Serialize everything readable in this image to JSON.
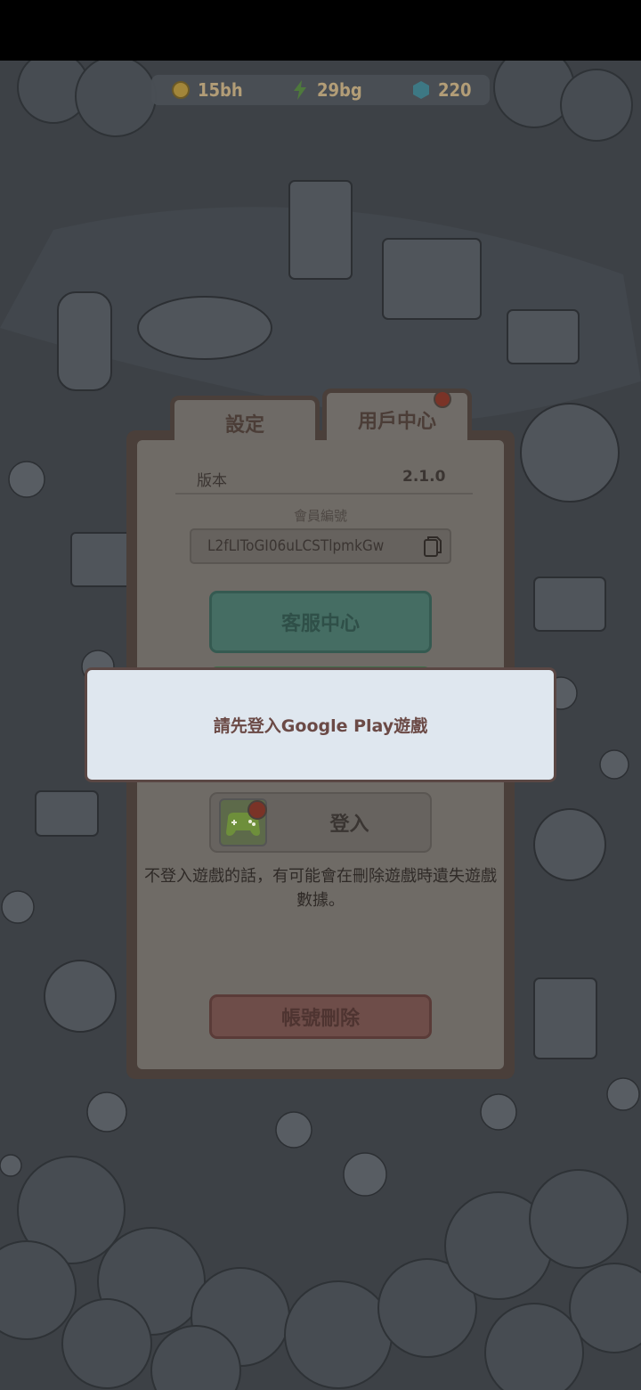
{
  "resources": [
    {
      "icon": "coin-icon",
      "value": "15bh"
    },
    {
      "icon": "lightning-icon",
      "value": "29bg"
    },
    {
      "icon": "gem-icon",
      "value": "220"
    }
  ],
  "tabs": {
    "settings": "設定",
    "user_center": "用戶中心"
  },
  "version": {
    "label": "版本",
    "value": "2.1.0"
  },
  "member": {
    "label": "會員編號",
    "id": "L2fLIToGI06uLCSTlpmkGw"
  },
  "buttons": {
    "customer_service": "客服中心",
    "login": "登入",
    "delete_account": "帳號刪除"
  },
  "warning_text": "不登入遊戲的話，有可能會在刪除遊戲時遺失遊戲數據。",
  "modal": {
    "message": "請先登入Google Play遊戲"
  },
  "colors": {
    "accent_teal": "#456d63",
    "danger": "#6e4d49",
    "modal_bg": "#dfe7ef"
  }
}
